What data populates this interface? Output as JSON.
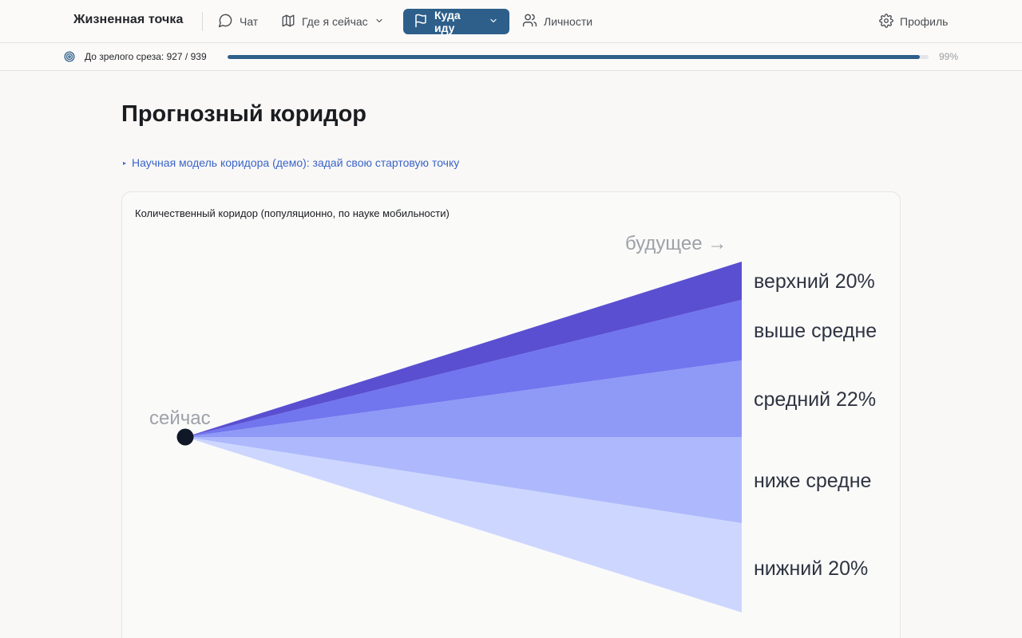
{
  "app": {
    "brand": "Жизненная точка"
  },
  "nav": {
    "chat": "Чат",
    "where": "Где я сейчас",
    "going": "Куда иду",
    "people": "Личности",
    "profile": "Профиль"
  },
  "progress": {
    "label": "До зрелого среза: 927 / 939",
    "percent_label": "99%",
    "value": 0.987,
    "color": "#2d5f8a"
  },
  "page": {
    "title": "Прогнозный коридор",
    "demo_link": "Научная модель коридора (демо): задай свою стартовую точку"
  },
  "card": {
    "title": "Количественный коридор (популяционно, по науке мобильности)"
  },
  "chart_data": {
    "type": "area",
    "start_label": "сейчас",
    "future_label": "будущее →",
    "bands": [
      {
        "label": "верхний 20%",
        "color": "#5a4fd1"
      },
      {
        "label": "выше средне",
        "color": "#7175ee"
      },
      {
        "label": "средний 22%",
        "color": "#8f99f6"
      },
      {
        "label": "ниже средне",
        "color": "#adb9fc"
      },
      {
        "label": "нижний 20%",
        "color": "#cdd6fe"
      }
    ]
  },
  "icons": [
    "chat-icon",
    "map-icon",
    "chevron-down-icon",
    "flag-icon",
    "people-icon",
    "gear-icon",
    "target-icon"
  ]
}
